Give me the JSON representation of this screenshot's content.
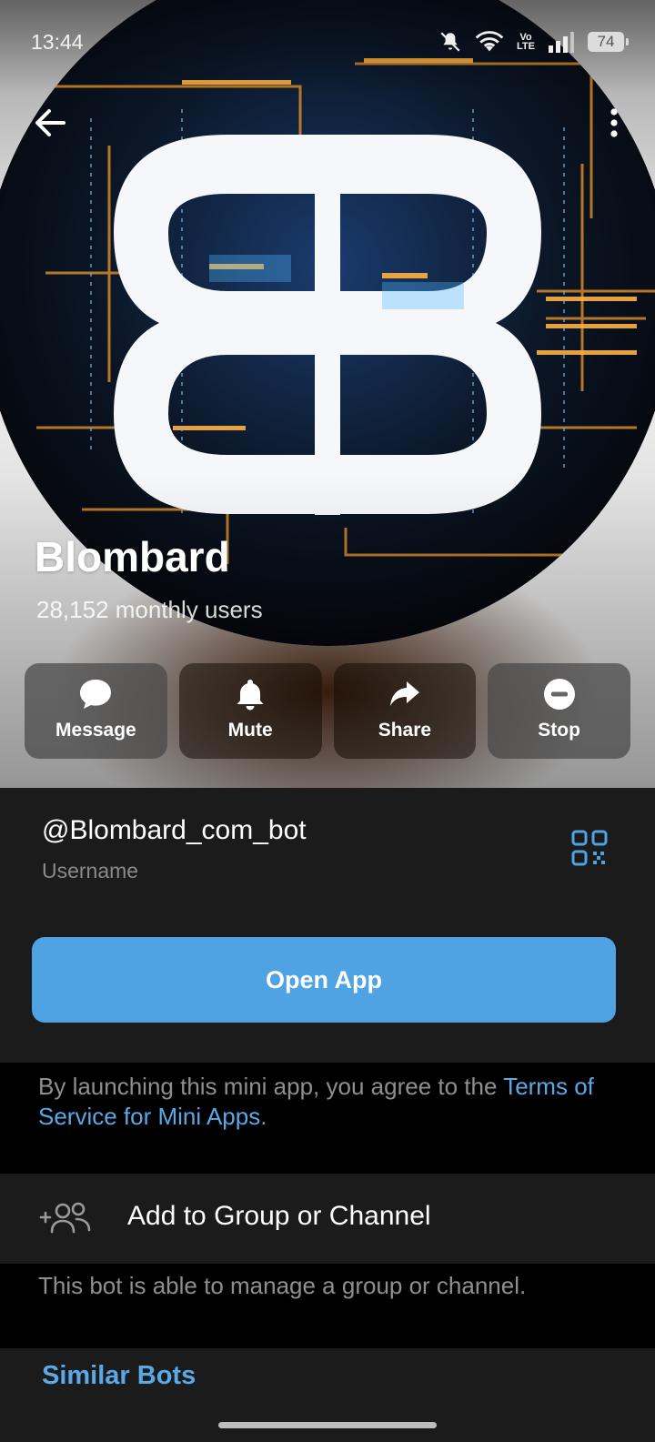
{
  "status_bar": {
    "time": "13:44",
    "battery": "74",
    "network_label_top": "Vo",
    "network_label_bottom": "LTE"
  },
  "icons": {
    "back": "arrow-left-icon",
    "more": "more-vertical-icon",
    "message": "chat-bubble-icon",
    "mute": "bell-icon",
    "share": "share-arrow-icon",
    "stop": "minus-circle-icon",
    "qr": "qr-code-icon",
    "add_group": "add-people-icon"
  },
  "profile": {
    "name": "Blombard",
    "stats": "28,152 monthly users"
  },
  "actions": [
    {
      "label": "Message"
    },
    {
      "label": "Mute"
    },
    {
      "label": "Share"
    },
    {
      "label": "Stop"
    }
  ],
  "info": {
    "username": "@Blombard_com_bot",
    "username_caption": "Username",
    "open_app_label": "Open App"
  },
  "terms": {
    "prefix": "By launching this mini app, you agree to the ",
    "link": "Terms of Service for Mini Apps",
    "suffix": "."
  },
  "add_group": {
    "label": "Add to Group or Channel",
    "note": "This bot is able to manage a group or channel."
  },
  "similar_bots": {
    "title": "Similar Bots"
  },
  "colors": {
    "accent": "#4fa3e2",
    "link": "#5aa8e6",
    "card_bg": "#1b1b1b",
    "page_bg": "#000000"
  }
}
